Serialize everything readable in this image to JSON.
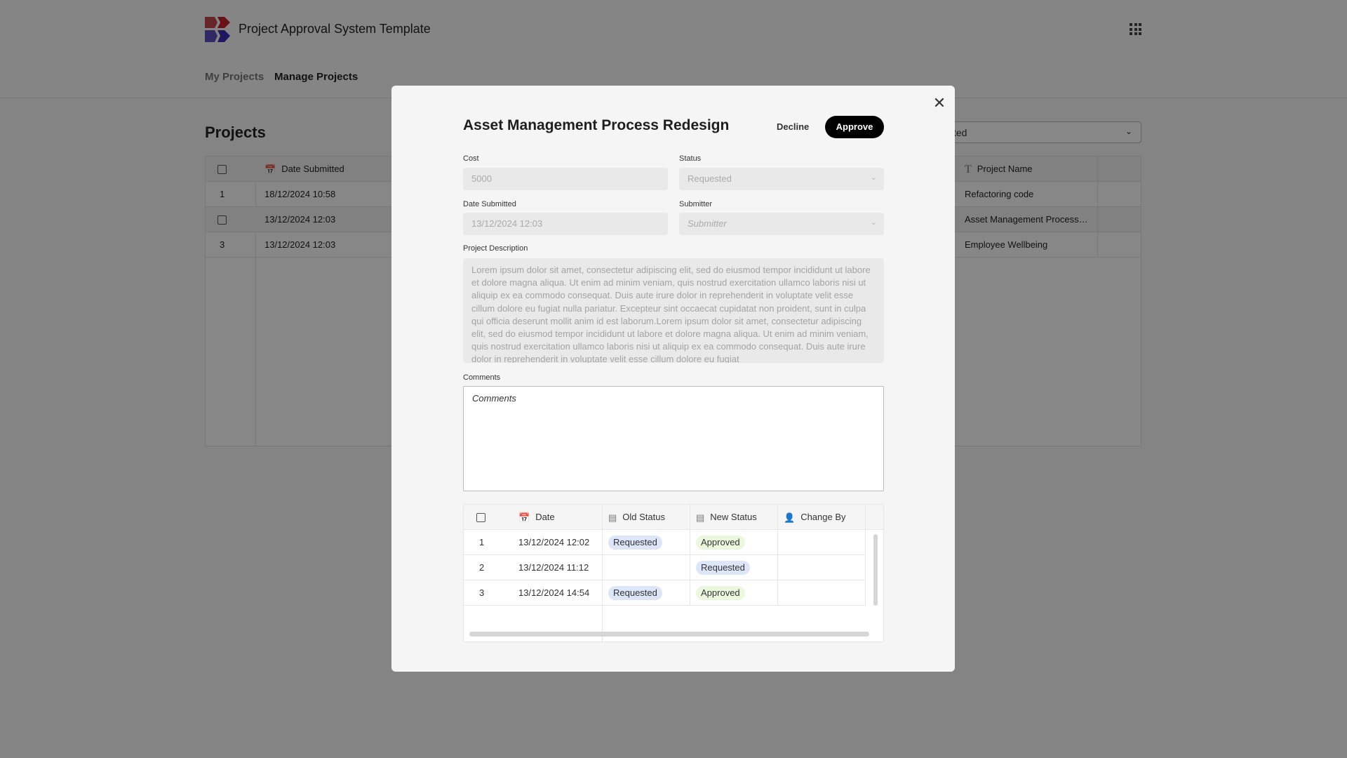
{
  "app": {
    "title": "Project Approval System Template",
    "grid_icon": "apps-grid-icon"
  },
  "nav": {
    "items": [
      {
        "label": "My Projects"
      },
      {
        "label": "Manage Projects"
      }
    ]
  },
  "page": {
    "title": "Projects",
    "filter_value": "ted"
  },
  "projects_table": {
    "columns": [
      "Date Submitted",
      "Project Name"
    ],
    "rows": [
      {
        "index": "1",
        "date": "18/12/2024 10:58",
        "name": "Refactoring code"
      },
      {
        "index": "",
        "date": "13/12/2024 12:03",
        "name": "Asset Management Process…"
      },
      {
        "index": "3",
        "date": "13/12/2024 12:03",
        "name": "Employee Wellbeing"
      }
    ]
  },
  "modal": {
    "title": "Asset Management Process Redesign",
    "decline_label": "Decline",
    "approve_label": "Approve",
    "cost": {
      "label": "Cost",
      "value": "5000"
    },
    "status": {
      "label": "Status",
      "value": "Requested"
    },
    "date_submitted": {
      "label": "Date Submitted",
      "value": "13/12/2024 12:03"
    },
    "submitter": {
      "label": "Submitter",
      "placeholder": "Submitter"
    },
    "description": {
      "label": "Project Description",
      "value": "Lorem ipsum dolor sit amet, consectetur adipiscing elit, sed do eiusmod tempor incididunt ut labore et dolore magna aliqua. Ut enim ad minim veniam, quis nostrud exercitation ullamco laboris nisi ut aliquip ex ea commodo consequat. Duis aute irure dolor in reprehenderit in voluptate velit esse cillum dolore eu fugiat nulla pariatur. Excepteur sint occaecat cupidatat non proident, sunt in culpa qui officia deserunt mollit anim id est laborum.Lorem ipsum dolor sit amet, consectetur adipiscing elit, sed do eiusmod tempor incididunt ut labore et dolore magna aliqua. Ut enim ad minim veniam, quis nostrud exercitation ullamco laboris nisi ut aliquip ex ea commodo consequat. Duis aute irure dolor in reprehenderit in voluptate velit esse cillum dolore eu fugiat"
    },
    "comments": {
      "label": "Comments",
      "placeholder": "Comments"
    },
    "history": {
      "columns": [
        "Date",
        "Old Status",
        "New Status",
        "Change By"
      ],
      "rows": [
        {
          "index": "1",
          "date": "13/12/2024 12:02",
          "old": "Requested",
          "new": "Approved",
          "by": ""
        },
        {
          "index": "2",
          "date": "13/12/2024 11:12",
          "old": "",
          "new": "Requested",
          "by": ""
        },
        {
          "index": "3",
          "date": "13/12/2024 14:54",
          "old": "Requested",
          "new": "Approved",
          "by": ""
        }
      ]
    }
  },
  "colors": {
    "requested_pill": "#dce6f8",
    "approved_pill": "#ebf8dd",
    "approve_button": "#000000"
  }
}
